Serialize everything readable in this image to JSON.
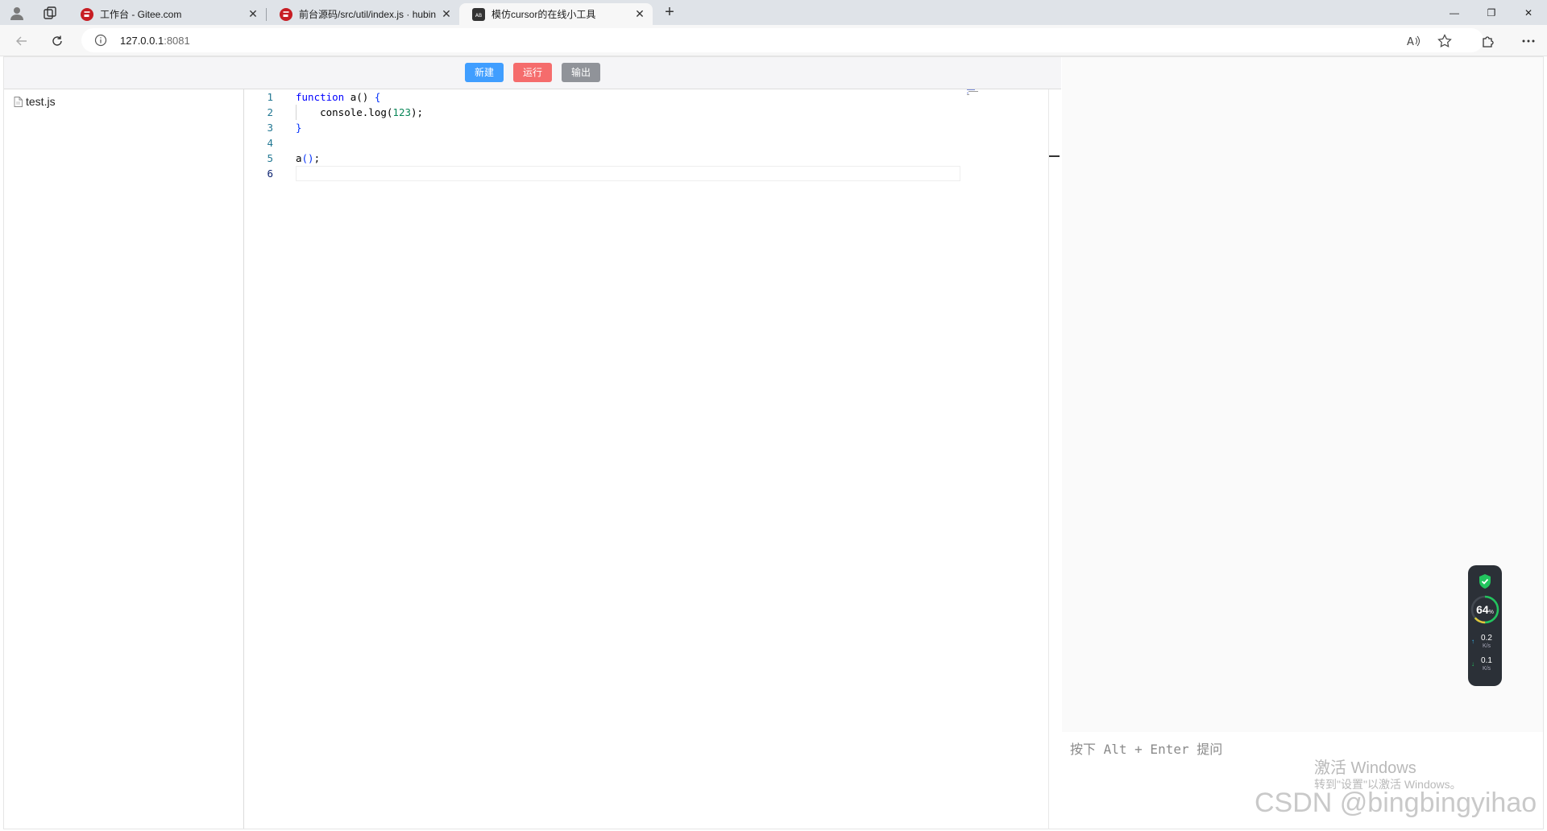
{
  "browser": {
    "tabs": [
      {
        "title": "工作台 - Gitee.com",
        "favicon": "gitee-icon"
      },
      {
        "title": "前台源码/src/util/index.js · hubin",
        "favicon": "gitee-icon"
      },
      {
        "title": "模仿cursor的在线小工具",
        "favicon": "site-icon"
      }
    ],
    "active_tab": 2,
    "new_tab": "+",
    "address": {
      "host": "127.0.0.1",
      "port": ":8081"
    },
    "window_controls": {
      "minimize": "—",
      "restore": "❐",
      "close": "✕"
    }
  },
  "toolbar": {
    "new_label": "新建",
    "run_label": "运行",
    "output_label": "输出",
    "colors": {
      "new": "#409eff",
      "run": "#f56c6c",
      "output": "#909399"
    }
  },
  "file_tree": {
    "files": [
      {
        "name": "test.js"
      }
    ]
  },
  "editor": {
    "line_numbers": [
      "1",
      "2",
      "3",
      "4",
      "5",
      "6"
    ],
    "lines": [
      {
        "kw": "function",
        "rest": " a() ",
        "br": "{"
      },
      {
        "plain": "    console.log(",
        "num": "123",
        "tail": ");"
      },
      {
        "br": "}"
      },
      {
        "plain": ""
      },
      {
        "plain": "a",
        "br": "()",
        "tail": ";"
      },
      {
        "plain": ""
      }
    ]
  },
  "chat": {
    "placeholder": "按下 Alt + Enter 提问"
  },
  "system_widget": {
    "percent": "64",
    "percent_unit": "%",
    "upload": "0.2",
    "upload_unit": "K/s",
    "download": "0.1",
    "download_unit": "K/s"
  },
  "watermark": {
    "activate_title": "激活 Windows",
    "activate_sub": "转到\"设置\"以激活 Windows。",
    "csdn": "CSDN @bingbingyihao"
  }
}
